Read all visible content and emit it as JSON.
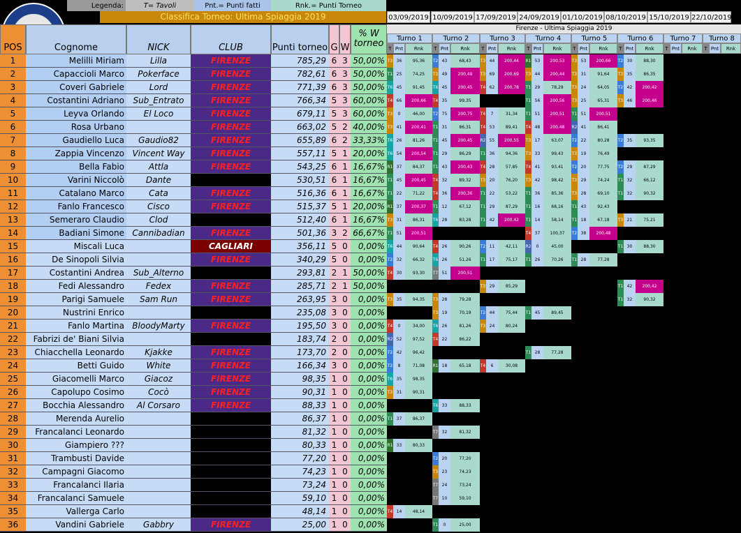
{
  "legend": {
    "label": "Legenda:",
    "tavoli": "T= Tavoli",
    "punti_fatti": "Pnt.= Punti fatti",
    "punti_torneo": "Rnk.= Punti Torneo"
  },
  "logo": {
    "arc_text": "MALEDETTI TOSCANI",
    "script": "Risiko!",
    "club_text": "OFFICIAL CLUB",
    "city": "FIRENZE"
  },
  "title": "Classifica Torneo: Ultima Spiaggia 2019",
  "dates": [
    "03/09/2019",
    "10/09/2019",
    "17/09/2019",
    "24/09/2019",
    "01/10/2019",
    "08/10/2019",
    "15/10/2019",
    "22/10/2019"
  ],
  "panel_title": "Firenze - Ultima Spiaggia 2019",
  "turni": [
    "Turno 1",
    "Turno 2",
    "Turno 3",
    "Turno 4",
    "Turno 5",
    "Turno 6",
    "Turno 7",
    "Turno 8"
  ],
  "sub_headers": {
    "t": "T",
    "pnt": "Pnt",
    "rnk": "Rnk"
  },
  "headers": {
    "pos": "POS",
    "cognome": "Cognome",
    "nick": "NICK",
    "club": "CLUB",
    "punti": "Punti torneo",
    "g": "G",
    "w": "W",
    "pct_line1": "% W",
    "pct_line2": "torneo"
  },
  "colors": {
    "row_orange": "#ee8f33",
    "row_blue": "#3b79d8",
    "club_purple": "#4a2a86",
    "club_cagliari": "#7a0000",
    "rank_hi": "#c4008c"
  },
  "rows": [
    {
      "pos": "1",
      "cognome": "Melilli Miriam",
      "nick": "Lilla",
      "club": "FIRENZE",
      "punti": "785,29",
      "g": "6",
      "w": "3",
      "pct": "50,00%",
      "t": [
        [
          "T3",
          "36",
          "95,36"
        ],
        [
          "T2",
          "43",
          "68,43"
        ],
        [
          "T3",
          "44",
          "200,44"
        ],
        [
          "R1",
          "53",
          "200,53"
        ],
        [
          "T3",
          "53",
          "200,66"
        ],
        [
          "T2",
          "30",
          "88,30"
        ]
      ]
    },
    {
      "pos": "2",
      "cognome": "Capaccioli Marco",
      "nick": "Pokerface",
      "club": "FIRENZE",
      "punti": "782,61",
      "g": "6",
      "w": "3",
      "pct": "50,00%",
      "t": [
        [
          "T1",
          "25",
          "74,25"
        ],
        [
          "T3",
          "49",
          "200,49"
        ],
        [
          "T3",
          "69",
          "200,69"
        ],
        [
          "T3",
          "44",
          "200,44"
        ],
        [
          "T3",
          "31",
          "91,64"
        ],
        [
          "T3",
          "35",
          "86,35"
        ]
      ]
    },
    {
      "pos": "3",
      "cognome": "Coveri Gabriele",
      "nick": "Lord",
      "club": "FIRENZE",
      "punti": "771,39",
      "g": "6",
      "w": "3",
      "pct": "50,00%",
      "t": [
        [
          "T6",
          "45",
          "91,45"
        ],
        [
          "T6",
          "45",
          "200,45"
        ],
        [
          "T4",
          "62",
          "200,78"
        ],
        [
          "T1",
          "29",
          "78,29"
        ],
        [
          "T3",
          "24",
          "64,05"
        ],
        [
          "T2",
          "42",
          "200,42"
        ]
      ]
    },
    {
      "pos": "4",
      "cognome": "Costantini Adriano",
      "nick": "Sub_Entrato",
      "club": "FIRENZE",
      "punti": "766,34",
      "g": "5",
      "w": "3",
      "pct": "60,00%",
      "t": [
        [
          "T4",
          "66",
          "200,66"
        ],
        [
          "T4",
          "35",
          "99,35"
        ],
        null,
        [
          "T1",
          "56",
          "200,56"
        ],
        [
          "T3",
          "25",
          "65,31"
        ],
        [
          "T3",
          "46",
          "200,46"
        ]
      ]
    },
    {
      "pos": "5",
      "cognome": "Leyva Orlando",
      "nick": "El Loco",
      "club": "FIRENZE",
      "punti": "679,11",
      "g": "5",
      "w": "3",
      "pct": "60,00%",
      "t": [
        [
          "T3",
          "0",
          "46,00"
        ],
        [
          "T2",
          "75",
          "200,75"
        ],
        [
          "T4",
          "7",
          "31,34"
        ],
        [
          "T1",
          "51",
          "200,51"
        ],
        [
          "T1",
          "51",
          "200,51"
        ],
        null
      ]
    },
    {
      "pos": "6",
      "cognome": "Rosa Urbano",
      "nick": "",
      "club": "FIRENZE",
      "punti": "663,02",
      "g": "5",
      "w": "2",
      "pct": "40,00%",
      "t": [
        [
          "T3",
          "41",
          "200,41"
        ],
        [
          "T1",
          "31",
          "86,31"
        ],
        [
          "T4",
          "53",
          "89,41"
        ],
        [
          "T4",
          "48",
          "200,48"
        ],
        [
          "R2",
          "41",
          "86,41"
        ],
        null
      ]
    },
    {
      "pos": "7",
      "cognome": "Gaudiello Luca",
      "nick": "Gaudio82",
      "club": "FIRENZE",
      "punti": "655,89",
      "g": "6",
      "w": "2",
      "pct": "33,33%",
      "t": [
        [
          "T6",
          "26",
          "81,26"
        ],
        [
          "T1",
          "45",
          "200,45"
        ],
        [
          "R2",
          "55",
          "200,55"
        ],
        [
          "T3",
          "17",
          "63,07"
        ],
        [
          "T2",
          "22",
          "80,28"
        ],
        [
          "T2",
          "35",
          "93,35"
        ]
      ]
    },
    {
      "pos": "8",
      "cognome": "Zappia Vincenzo",
      "nick": "Vincent Way",
      "club": "FIRENZE",
      "punti": "557,11",
      "g": "5",
      "w": "1",
      "pct": "20,00%",
      "t": [
        [
          "T6",
          "54",
          "200,54"
        ],
        [
          "T1",
          "29",
          "86,29"
        ],
        [
          "T1",
          "36",
          "94,36"
        ],
        [
          "T3",
          "33",
          "99,43"
        ],
        [
          "T3",
          "19",
          "76,49"
        ],
        null
      ]
    },
    {
      "pos": "9",
      "cognome": "Bella Fabio",
      "nick": "Attla",
      "club": "FIRENZE",
      "punti": "543,25",
      "g": "6",
      "w": "1",
      "pct": "16,67%",
      "t": [
        [
          "R1",
          "37",
          "84,37"
        ],
        [
          "T1",
          "43",
          "200,43"
        ],
        [
          "T4",
          "28",
          "57,85"
        ],
        [
          "T4",
          "41",
          "93,41"
        ],
        [
          "T2",
          "20",
          "77,75"
        ],
        [
          "T2",
          "29",
          "87,29"
        ]
      ]
    },
    {
      "pos": "10",
      "cognome": "Varini Niccolò",
      "nick": "Dante",
      "club": "",
      "punti": "530,51",
      "g": "6",
      "w": "1",
      "pct": "16,67%",
      "t": [
        [
          "T1",
          "45",
          "200,45"
        ],
        [
          "T4",
          "32",
          "89,32"
        ],
        [
          "T3",
          "20",
          "76,20"
        ],
        [
          "T3",
          "42",
          "98,42"
        ],
        [
          "T3",
          "29",
          "74,24"
        ],
        [
          "T1",
          "32",
          "66,12"
        ]
      ]
    },
    {
      "pos": "11",
      "cognome": "Catalano Marco",
      "nick": "Cata",
      "club": "FIRENZE",
      "punti": "516,36",
      "g": "6",
      "w": "1",
      "pct": "16,67%",
      "t": [
        [
          "T1",
          "22",
          "71,22"
        ],
        [
          "T4",
          "36",
          "200,36"
        ],
        [
          "T1",
          "22",
          "53,22"
        ],
        [
          "T1",
          "36",
          "85,36"
        ],
        [
          "T3",
          "28",
          "69,10"
        ],
        [
          "T1",
          "32",
          "90,32"
        ]
      ]
    },
    {
      "pos": "12",
      "cognome": "Fanlo Francesco",
      "nick": "Cisco",
      "club": "FIRENZE",
      "punti": "515,37",
      "g": "5",
      "w": "1",
      "pct": "20,00%",
      "t": [
        [
          "R1",
          "37",
          "200,37"
        ],
        [
          "T1",
          "12",
          "67,12"
        ],
        [
          "T1",
          "29",
          "87,29"
        ],
        [
          "T1",
          "16",
          "68,16"
        ],
        [
          "T1",
          "43",
          "92,43"
        ],
        null
      ]
    },
    {
      "pos": "13",
      "cognome": "Semeraro Claudio",
      "nick": "Clod",
      "club": "",
      "punti": "512,40",
      "g": "6",
      "w": "1",
      "pct": "16,67%",
      "t": [
        [
          "T3",
          "31",
          "86,31"
        ],
        [
          "T6",
          "28",
          "83,28"
        ],
        [
          "T1",
          "42",
          "200,42"
        ],
        [
          "T1",
          "14",
          "58,14"
        ],
        [
          "T1",
          "18",
          "67,18"
        ],
        [
          "T3",
          "21",
          "75,21"
        ]
      ]
    },
    {
      "pos": "14",
      "cognome": "Badiani Simone",
      "nick": "Cannibadian",
      "club": "FIRENZE",
      "punti": "501,36",
      "g": "3",
      "w": "2",
      "pct": "66,67%",
      "t": [
        [
          "T1",
          "51",
          "200,51"
        ],
        null,
        null,
        [
          "T4",
          "37",
          "100,37"
        ],
        [
          "T2",
          "38",
          "200,48"
        ],
        null
      ]
    },
    {
      "pos": "15",
      "cognome": "Miscali Luca",
      "nick": "",
      "club": "CAGLIARI",
      "punti": "356,11",
      "g": "5",
      "w": "0",
      "pct": "0,00%",
      "t": [
        [
          "T6",
          "44",
          "90,64"
        ],
        [
          "T4",
          "26",
          "90,26"
        ],
        [
          "T2",
          "11",
          "42,11"
        ],
        [
          "R2",
          "0",
          "45,00"
        ],
        null,
        [
          "T1",
          "30",
          "88,30"
        ]
      ]
    },
    {
      "pos": "16",
      "cognome": "De Sinopoli Silvia",
      "nick": "",
      "club": "FIRENZE",
      "punti": "340,29",
      "g": "5",
      "w": "0",
      "pct": "0,00%",
      "t": [
        [
          "T2",
          "32",
          "66,32"
        ],
        [
          "T6",
          "26",
          "51,26"
        ],
        [
          "T1",
          "17",
          "75,17"
        ],
        [
          "T1",
          "26",
          "70,26"
        ],
        [
          "T1",
          "28",
          "77,28"
        ],
        null
      ]
    },
    {
      "pos": "17",
      "cognome": "Costantini Andrea",
      "nick": "Sub_Alterno",
      "club": "",
      "punti": "293,81",
      "g": "2",
      "w": "1",
      "pct": "50,00%",
      "t": [
        [
          "T4",
          "30",
          "93,30"
        ],
        [
          "T7",
          "51",
          "200,51"
        ],
        null,
        null,
        null,
        null
      ]
    },
    {
      "pos": "18",
      "cognome": "Fedi Alessandro",
      "nick": "Fedex",
      "club": "FIRENZE",
      "punti": "285,71",
      "g": "2",
      "w": "1",
      "pct": "50,00%",
      "t": [
        null,
        null,
        [
          "T3",
          "29",
          "85,29"
        ],
        null,
        null,
        [
          "T1",
          "42",
          "200,42"
        ]
      ]
    },
    {
      "pos": "19",
      "cognome": "Parigi Samuele",
      "nick": "Sam Run",
      "club": "FIRENZE",
      "punti": "263,95",
      "g": "3",
      "w": "0",
      "pct": "0,00%",
      "t": [
        [
          "T3",
          "35",
          "94,35"
        ],
        [
          "T3",
          "28",
          "79,28"
        ],
        null,
        null,
        null,
        [
          "T1",
          "32",
          "90,32"
        ]
      ]
    },
    {
      "pos": "20",
      "cognome": "Nustrini Enrico",
      "nick": "",
      "club": "",
      "punti": "235,08",
      "g": "3",
      "w": "0",
      "pct": "0,00%",
      "t": [
        null,
        [
          "T3",
          "19",
          "70,19"
        ],
        [
          "T2",
          "44",
          "75,44"
        ],
        [
          "T1",
          "45",
          "89,45"
        ],
        null,
        null
      ]
    },
    {
      "pos": "21",
      "cognome": "Fanlo Martina",
      "nick": "BloodyMarty",
      "club": "FIRENZE",
      "punti": "195,50",
      "g": "3",
      "w": "0",
      "pct": "0,00%",
      "t": [
        [
          "T4",
          "0",
          "34,00"
        ],
        [
          "T6",
          "26",
          "81,26"
        ],
        [
          "T3",
          "24",
          "80,24"
        ],
        null,
        null,
        null
      ]
    },
    {
      "pos": "22",
      "cognome": "Fabrizi de' Biani Silvia",
      "nick": "",
      "club": "",
      "punti": "183,74",
      "g": "2",
      "w": "0",
      "pct": "0,00%",
      "t": [
        [
          "R2",
          "52",
          "97,52"
        ],
        [
          "T4",
          "22",
          "86,22"
        ],
        null,
        null,
        null,
        null
      ]
    },
    {
      "pos": "23",
      "cognome": "Chiacchella Leonardo",
      "nick": "Kjakke",
      "club": "FIRENZE",
      "punti": "173,70",
      "g": "2",
      "w": "0",
      "pct": "0,00%",
      "t": [
        [
          "T2",
          "42",
          "96,42"
        ],
        null,
        null,
        [
          "T1",
          "28",
          "77,28"
        ],
        null,
        null
      ]
    },
    {
      "pos": "24",
      "cognome": "Betti Guido",
      "nick": "White",
      "club": "FIRENZE",
      "punti": "166,34",
      "g": "3",
      "w": "0",
      "pct": "0,00%",
      "t": [
        [
          "T2",
          "8",
          "71,08"
        ],
        [
          "R1",
          "18",
          "65,18"
        ],
        [
          "T4",
          "6",
          "30,08"
        ],
        null,
        null,
        null
      ]
    },
    {
      "pos": "25",
      "cognome": "Giacomelli Marco",
      "nick": "Giacoz",
      "club": "FIRENZE",
      "punti": "98,35",
      "g": "1",
      "w": "0",
      "pct": "0,00%",
      "t": [
        [
          "T6",
          "35",
          "98,35"
        ],
        null,
        null,
        null,
        null,
        null
      ]
    },
    {
      "pos": "26",
      "cognome": "Capolupo Cosimo",
      "nick": "Cocò",
      "club": "FIRENZE",
      "punti": "90,31",
      "g": "1",
      "w": "0",
      "pct": "0,00%",
      "t": [
        [
          "T3",
          "31",
          "90,31"
        ],
        null,
        null,
        null,
        null,
        null
      ]
    },
    {
      "pos": "27",
      "cognome": "Bocchia Alessandro",
      "nick": "Al Corsaro",
      "club": "FIRENZE",
      "punti": "88,33",
      "g": "1",
      "w": "0",
      "pct": "0,00%",
      "t": [
        null,
        [
          "T6",
          "33",
          "88,33"
        ],
        null,
        null,
        null,
        null
      ]
    },
    {
      "pos": "28",
      "cognome": "Merenda Aurelio",
      "nick": "",
      "club": "",
      "punti": "86,37",
      "g": "1",
      "w": "0",
      "pct": "0,00%",
      "t": [
        [
          "T1",
          "37",
          "86,37"
        ],
        null,
        null,
        null,
        null,
        null
      ]
    },
    {
      "pos": "29",
      "cognome": "Francalanci Leonardo",
      "nick": "",
      "club": "",
      "punti": "81,32",
      "g": "1",
      "w": "0",
      "pct": "0,00%",
      "t": [
        null,
        [
          "T7",
          "32",
          "81,32"
        ],
        null,
        null,
        null,
        null
      ]
    },
    {
      "pos": "30",
      "cognome": "Giampiero ???",
      "nick": "",
      "club": "",
      "punti": "80,33",
      "g": "1",
      "w": "0",
      "pct": "0,00%",
      "t": [
        [
          "R1",
          "33",
          "80,33"
        ],
        null,
        null,
        null,
        null,
        null
      ]
    },
    {
      "pos": "31",
      "cognome": "Trambusti Davide",
      "nick": "",
      "club": "",
      "punti": "77,20",
      "g": "1",
      "w": "0",
      "pct": "0,00%",
      "t": [
        null,
        [
          "T2",
          "20",
          "77,20"
        ],
        null,
        null,
        null,
        null
      ]
    },
    {
      "pos": "32",
      "cognome": "Campagni Giacomo",
      "nick": "",
      "club": "",
      "punti": "74,23",
      "g": "1",
      "w": "0",
      "pct": "0,00%",
      "t": [
        null,
        [
          "T3",
          "23",
          "74,23"
        ],
        null,
        null,
        null,
        null
      ]
    },
    {
      "pos": "33",
      "cognome": "Francalanci Ilaria",
      "nick": "",
      "club": "",
      "punti": "73,24",
      "g": "1",
      "w": "0",
      "pct": "0,00%",
      "t": [
        null,
        [
          "T7",
          "24",
          "73,24"
        ],
        null,
        null,
        null,
        null
      ]
    },
    {
      "pos": "34",
      "cognome": "Francalanci Samuele",
      "nick": "",
      "club": "",
      "punti": "59,10",
      "g": "1",
      "w": "0",
      "pct": "0,00%",
      "t": [
        null,
        [
          "T7",
          "10",
          "59,10"
        ],
        null,
        null,
        null,
        null
      ]
    },
    {
      "pos": "35",
      "cognome": "Vallerga Carlo",
      "nick": "",
      "club": "",
      "punti": "48,14",
      "g": "1",
      "w": "0",
      "pct": "0,00%",
      "t": [
        [
          "T4",
          "14",
          "48,14"
        ],
        null,
        null,
        null,
        null,
        null
      ]
    },
    {
      "pos": "36",
      "cognome": "Vandini Gabriele",
      "nick": "Gabbry",
      "club": "FIRENZE",
      "punti": "25,00",
      "g": "1",
      "w": "0",
      "pct": "0,00%",
      "t": [
        null,
        [
          "T1",
          "0",
          "25,00"
        ],
        null,
        null,
        null,
        null
      ]
    }
  ]
}
